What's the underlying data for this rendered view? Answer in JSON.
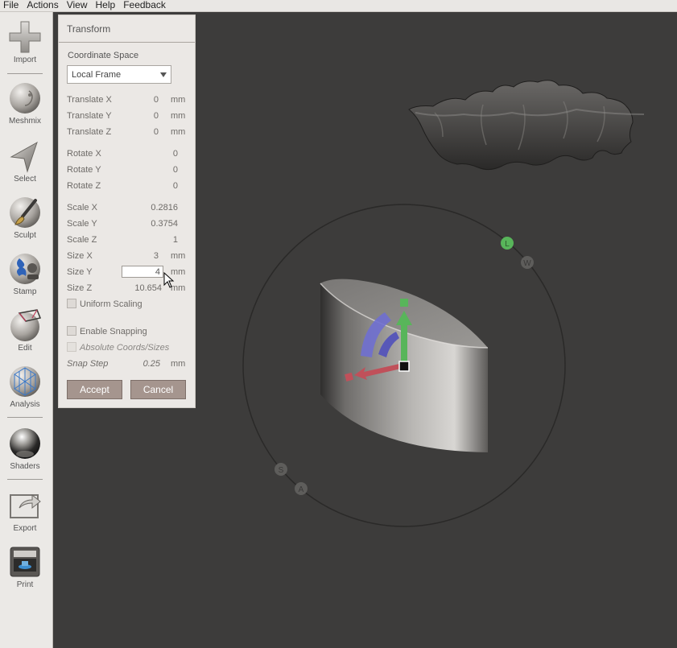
{
  "menu": [
    "File",
    "Actions",
    "View",
    "Help",
    "Feedback"
  ],
  "toolbar": {
    "items": [
      {
        "label": "Import",
        "icon": "plus-icon"
      },
      {
        "label": "Meshmix",
        "icon": "meshmix-icon"
      },
      {
        "label": "Select",
        "icon": "select-arrow-icon"
      },
      {
        "label": "Sculpt",
        "icon": "brush-icon"
      },
      {
        "label": "Stamp",
        "icon": "stamp-icon"
      },
      {
        "label": "Edit",
        "icon": "edit-icon"
      },
      {
        "label": "Analysis",
        "icon": "analysis-icon"
      },
      {
        "label": "Shaders",
        "icon": "shader-sphere-icon"
      },
      {
        "label": "Export",
        "icon": "export-icon"
      },
      {
        "label": "Print",
        "icon": "printer-icon"
      }
    ]
  },
  "panel": {
    "title": "Transform",
    "coordinate_space": {
      "label": "Coordinate Space",
      "selected": "Local Frame"
    },
    "translate": [
      {
        "label": "Translate X",
        "value": "0",
        "unit": "mm"
      },
      {
        "label": "Translate Y",
        "value": "0",
        "unit": "mm"
      },
      {
        "label": "Translate Z",
        "value": "0",
        "unit": "mm"
      }
    ],
    "rotate": [
      {
        "label": "Rotate X",
        "value": "0"
      },
      {
        "label": "Rotate Y",
        "value": "0"
      },
      {
        "label": "Rotate Z",
        "value": "0"
      }
    ],
    "scale": [
      {
        "label": "Scale X",
        "value": "0.2816"
      },
      {
        "label": "Scale Y",
        "value": "0.3754"
      },
      {
        "label": "Scale Z",
        "value": "1"
      }
    ],
    "size": {
      "x": {
        "label": "Size X",
        "value": "3",
        "unit": "mm"
      },
      "y": {
        "label": "Size Y",
        "value": "4",
        "unit": "mm"
      },
      "z": {
        "label": "Size Z",
        "value": "10.654",
        "unit": "mm"
      }
    },
    "uniform_scaling": {
      "label": "Uniform Scaling",
      "checked": false
    },
    "enable_snapping": {
      "label": "Enable Snapping",
      "checked": false
    },
    "absolute_coords": {
      "label": "Absolute Coords/Sizes",
      "checked": false
    },
    "snap_step": {
      "label": "Snap Step",
      "value": "0.25",
      "unit": "mm"
    },
    "accept_label": "Accept",
    "cancel_label": "Cancel"
  },
  "gizmo": {
    "ring_labels": [
      "L",
      "W",
      "S",
      "A"
    ],
    "colors": {
      "x": "#c0505a",
      "y": "#58b55a",
      "z": "#6f6fd0",
      "ring": "#2b2a29"
    }
  }
}
